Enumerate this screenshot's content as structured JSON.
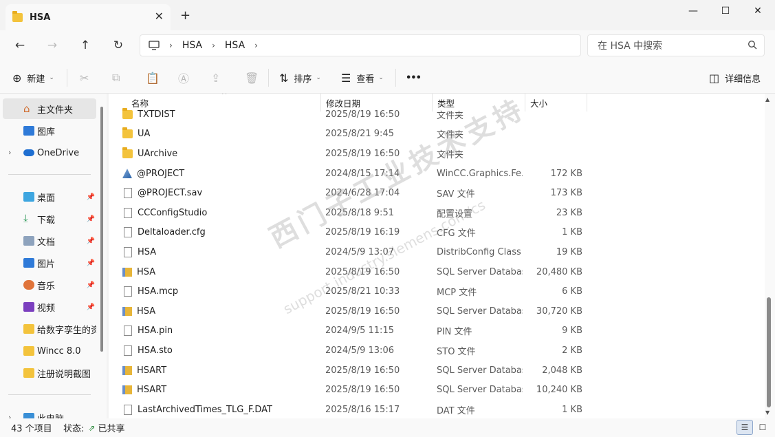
{
  "tab": {
    "title": "HSA",
    "close": "✕",
    "new_tab": "+"
  },
  "window": {
    "minimize": "—",
    "maximize": "☐",
    "close": "✕"
  },
  "nav": {
    "back": "←",
    "forward": "→",
    "up": "↑",
    "refresh": "↻",
    "breadcrumb": [
      "HSA",
      "HSA"
    ],
    "search_placeholder": "在 HSA 中搜索"
  },
  "toolbar": {
    "new_label": "新建",
    "sort_label": "排序",
    "view_label": "查看",
    "more": "•••",
    "details_label": "详细信息"
  },
  "sidebar": {
    "home": "主文件夹",
    "gallery": "图库",
    "onedrive": "OneDrive",
    "quick": [
      {
        "label": "桌面",
        "pinned": true
      },
      {
        "label": "下载",
        "pinned": true
      },
      {
        "label": "文档",
        "pinned": true
      },
      {
        "label": "图片",
        "pinned": true
      },
      {
        "label": "音乐",
        "pinned": true
      },
      {
        "label": "视频",
        "pinned": true
      },
      {
        "label": "给数字孪生的资",
        "pinned": false
      },
      {
        "label": "Wincc 8.0",
        "pinned": false
      },
      {
        "label": "注册说明截图",
        "pinned": false
      }
    ],
    "this_pc": "此电脑"
  },
  "columns": {
    "name": "名称",
    "date": "修改日期",
    "type": "类型",
    "size": "大小"
  },
  "files": [
    {
      "icon": "folder",
      "name": "TXTDIST",
      "date": "2025/8/19 16:50",
      "type": "文件夹",
      "size": ""
    },
    {
      "icon": "folder",
      "name": "UA",
      "date": "2025/8/21 9:45",
      "type": "文件夹",
      "size": ""
    },
    {
      "icon": "folder",
      "name": "UArchive",
      "date": "2025/8/19 16:50",
      "type": "文件夹",
      "size": ""
    },
    {
      "icon": "wincc",
      "name": "@PROJECT",
      "date": "2024/8/15 17:14",
      "type": "WinCC.Graphics.Fe...",
      "size": "172 KB"
    },
    {
      "icon": "file",
      "name": "@PROJECT.sav",
      "date": "2024/6/28 17:04",
      "type": "SAV 文件",
      "size": "173 KB"
    },
    {
      "icon": "file",
      "name": "CCConfigStudio",
      "date": "2025/8/18 9:51",
      "type": "配置设置",
      "size": "23 KB"
    },
    {
      "icon": "file",
      "name": "Deltaloader.cfg",
      "date": "2025/8/19 16:19",
      "type": "CFG 文件",
      "size": "1 KB"
    },
    {
      "icon": "file",
      "name": "HSA",
      "date": "2024/5/9 13:07",
      "type": "DistribConfig Class",
      "size": "19 KB"
    },
    {
      "icon": "db",
      "name": "HSA",
      "date": "2025/8/19 16:50",
      "type": "SQL Server Databas...",
      "size": "20,480 KB"
    },
    {
      "icon": "file",
      "name": "HSA.mcp",
      "date": "2025/8/21 10:33",
      "type": "MCP 文件",
      "size": "6 KB"
    },
    {
      "icon": "db",
      "name": "HSA",
      "date": "2025/8/19 16:50",
      "type": "SQL Server Databas...",
      "size": "30,720 KB"
    },
    {
      "icon": "file",
      "name": "HSA.pin",
      "date": "2024/9/5 11:15",
      "type": "PIN 文件",
      "size": "9 KB"
    },
    {
      "icon": "file",
      "name": "HSA.sto",
      "date": "2024/5/9 13:06",
      "type": "STO 文件",
      "size": "2 KB"
    },
    {
      "icon": "db",
      "name": "HSART",
      "date": "2025/8/19 16:50",
      "type": "SQL Server Databas...",
      "size": "2,048 KB"
    },
    {
      "icon": "db",
      "name": "HSART",
      "date": "2025/8/19 16:50",
      "type": "SQL Server Databas...",
      "size": "10,240 KB"
    },
    {
      "icon": "file",
      "name": "LastArchivedTimes_TLG_F.DAT",
      "date": "2025/8/16 15:17",
      "type": "DAT 文件",
      "size": "1 KB"
    }
  ],
  "watermark": {
    "cn": "西门子工业技术支持",
    "url": "support.industry.siemens.com/cs"
  },
  "status": {
    "count": "43 个项目",
    "state_label": "状态:",
    "state_value": "已共享"
  }
}
